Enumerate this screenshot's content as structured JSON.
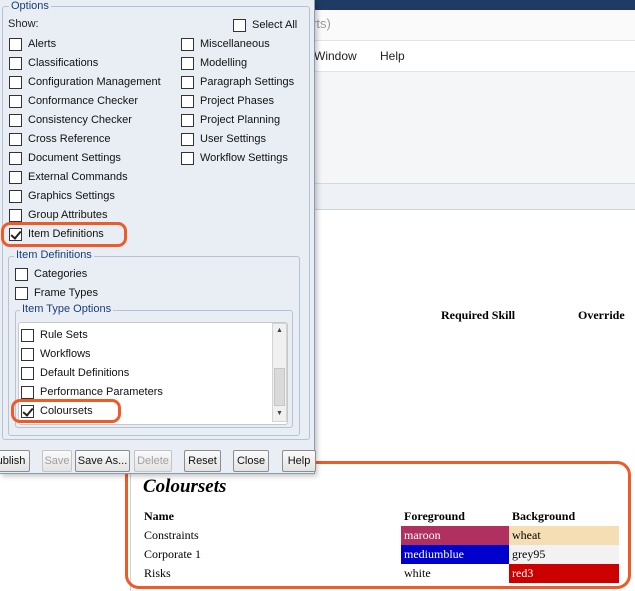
{
  "background_app": {
    "title_fragment": "rts)",
    "menu": [
      "Window",
      "Help"
    ],
    "table_headers": [
      "Required Skill",
      "Override"
    ]
  },
  "options_dialog": {
    "group_title": "Options",
    "show_label": "Show:",
    "select_all_label": "Select All",
    "left_items": [
      {
        "label": "Alerts",
        "checked": false
      },
      {
        "label": "Classifications",
        "checked": false
      },
      {
        "label": "Configuration Management",
        "checked": false
      },
      {
        "label": "Conformance Checker",
        "checked": false
      },
      {
        "label": "Consistency Checker",
        "checked": false
      },
      {
        "label": "Cross Reference",
        "checked": false
      },
      {
        "label": "Document Settings",
        "checked": false
      },
      {
        "label": "External Commands",
        "checked": false
      },
      {
        "label": "Graphics Settings",
        "checked": false
      },
      {
        "label": "Group Attributes",
        "checked": false
      },
      {
        "label": "Item Definitions",
        "checked": true
      }
    ],
    "right_items": [
      {
        "label": "Miscellaneous",
        "checked": false
      },
      {
        "label": "Modelling",
        "checked": false
      },
      {
        "label": "Paragraph Settings",
        "checked": false
      },
      {
        "label": "Project Phases",
        "checked": false
      },
      {
        "label": "Project Planning",
        "checked": false
      },
      {
        "label": "User Settings",
        "checked": false
      },
      {
        "label": "Workflow Settings",
        "checked": false
      }
    ],
    "item_definitions": {
      "title": "Item Definitions",
      "items": [
        {
          "label": "Categories",
          "checked": false
        },
        {
          "label": "Frame Types",
          "checked": false
        }
      ],
      "item_type_options": {
        "title": "Item Type Options",
        "items": [
          {
            "label": "Rule Sets",
            "checked": false
          },
          {
            "label": "Workflows",
            "checked": false
          },
          {
            "label": "Default Definitions",
            "checked": false
          },
          {
            "label": "Performance Parameters",
            "checked": false
          },
          {
            "label": "Coloursets",
            "checked": true
          }
        ]
      }
    },
    "buttons": [
      {
        "label": "ublish",
        "enabled": true
      },
      {
        "label": "Save",
        "enabled": false
      },
      {
        "label": "Save As...",
        "enabled": true
      },
      {
        "label": "Delete",
        "enabled": false
      },
      {
        "label": "Reset",
        "enabled": true
      },
      {
        "label": "Close",
        "enabled": true
      },
      {
        "label": "Help",
        "enabled": true
      }
    ]
  },
  "coloursets_section": {
    "title": "Coloursets",
    "headers": {
      "name": "Name",
      "foreground": "Foreground",
      "background": "Background"
    },
    "rows": [
      {
        "name": "Constraints",
        "foreground": "maroon",
        "background": "wheat",
        "fg_color": "#b03060",
        "fg_text_color": "#ffffff",
        "bg_color": "#f5deb3",
        "bg_text_color": "#000000"
      },
      {
        "name": "Corporate 1",
        "foreground": "mediumblue",
        "background": "grey95",
        "fg_color": "#0000cd",
        "fg_text_color": "#ffffff",
        "bg_color": "#f2f2f2",
        "bg_text_color": "#000000"
      },
      {
        "name": "Risks",
        "foreground": "white",
        "background": "red3",
        "fg_color": "#ffffff",
        "fg_text_color": "#000000",
        "bg_color": "#cd0000",
        "bg_text_color": "#ffffff"
      }
    ]
  },
  "colors": {
    "highlight": "#ee5a28",
    "dialog_background": "#e9eef5",
    "legend_text": "#1a3d78"
  }
}
